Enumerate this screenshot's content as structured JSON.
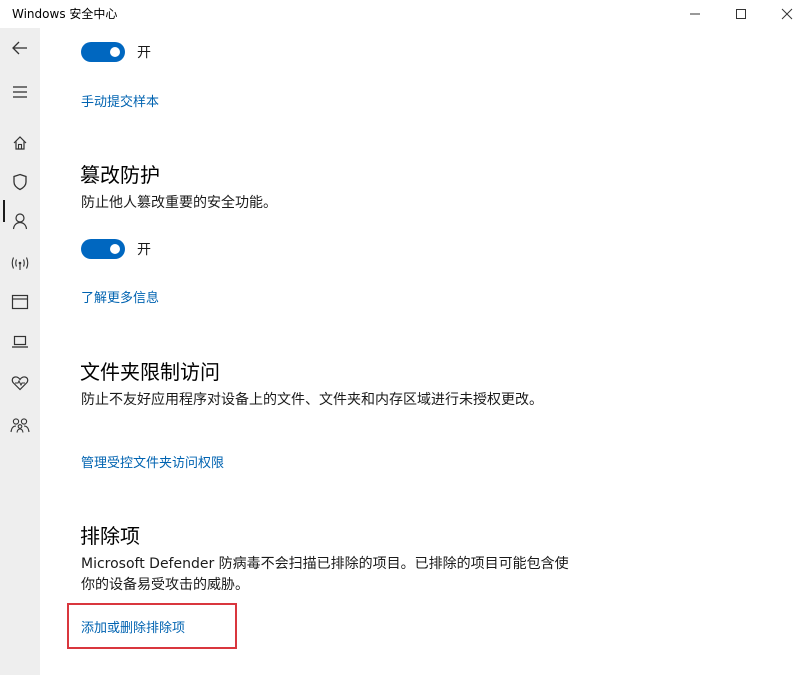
{
  "window": {
    "title": "Windows 安全中心"
  },
  "sidebar": {
    "icons": [
      "back-arrow-icon",
      "hamburger-menu-icon",
      "home-icon",
      "shield-icon",
      "person-icon",
      "wireless-icon",
      "browser-window-icon",
      "laptop-icon",
      "heart-health-icon",
      "family-icon"
    ],
    "active": "shield-icon"
  },
  "sections": {
    "top": {
      "toggle_label": "开",
      "link": "手动提交样本"
    },
    "tamper": {
      "title": "篡改防护",
      "description": "防止他人篡改重要的安全功能。",
      "toggle_label": "开",
      "link": "了解更多信息"
    },
    "folder": {
      "title": "文件夹限制访问",
      "description": "防止不友好应用程序对设备上的文件、文件夹和内存区域进行未授权更改。",
      "link": "管理受控文件夹访问权限"
    },
    "exclusions": {
      "title": "排除项",
      "description": "Microsoft Defender 防病毒不会扫描已排除的项目。已排除的项目可能包含使你的设备易受攻击的威胁。",
      "link": "添加或删除排除项"
    }
  },
  "colors": {
    "accent": "#0067c0",
    "link": "#0063b1",
    "highlight": "#d9363e",
    "sidebar_bg": "#eeeeee"
  }
}
